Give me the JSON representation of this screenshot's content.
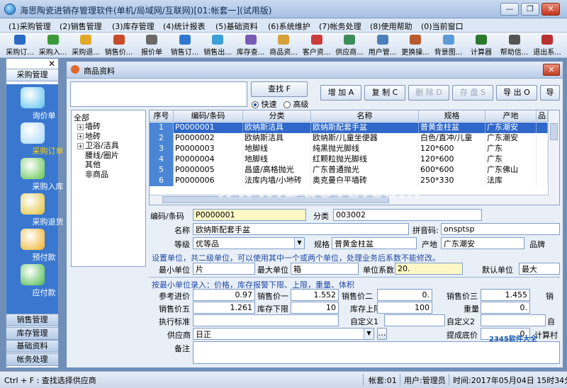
{
  "window": {
    "title": "海思陶瓷进销存管理软件(单机/局域网/互联网)[01:帐套一](试用版)",
    "buttons": [
      "—",
      "❐",
      "✕"
    ]
  },
  "menu": [
    "(1)采购管理",
    "(2)销售管理",
    "(3)库存管理",
    "(4)统计报表",
    "(5)基础资料",
    "(6)系统维护",
    "(7)帐务处理",
    "(8)使用帮助",
    "(0)当前窗口"
  ],
  "toolbar": [
    {
      "label": "采购订...",
      "color": "#2a6bc4"
    },
    {
      "label": "采购入...",
      "color": "#3a9a3a"
    },
    {
      "label": "采购退...",
      "color": "#e1a92a"
    },
    {
      "label": "销售价...",
      "color": "#c84b2a"
    },
    {
      "label": "报价单",
      "color": "#6b6b6b"
    },
    {
      "label": "销售订...",
      "color": "#2f78cf"
    },
    {
      "label": "销售出...",
      "color": "#3aa0d8"
    },
    {
      "label": "库存查...",
      "color": "#7a5bb8"
    },
    {
      "label": "商品资...",
      "color": "#d6a13a"
    },
    {
      "label": "客户资...",
      "color": "#cc3b3b"
    },
    {
      "label": "供应商...",
      "color": "#3c8d5b"
    },
    {
      "label": "用户管...",
      "color": "#4d7fb8"
    },
    {
      "label": "更换操...",
      "color": "#b85a2e"
    },
    {
      "label": "背景图...",
      "color": "#5b9bd8"
    },
    {
      "label": "计算器",
      "color": "#2b7a2b"
    },
    {
      "label": "帮助信...",
      "color": "#555"
    },
    {
      "label": "退出系...",
      "color": "#bb3030"
    }
  ],
  "sidebar": {
    "close": "✕",
    "top_group": "采购管理",
    "items": [
      {
        "label": "询价单",
        "color": "#58c0f0",
        "selected": false
      },
      {
        "label": "采购订单",
        "color": "#a8d8ff",
        "selected": true
      },
      {
        "label": "采购入库",
        "color": "#5ec44a",
        "selected": false
      },
      {
        "label": "采购退货",
        "color": "#e0c030",
        "selected": false
      },
      {
        "label": "预付款",
        "color": "#f0b020",
        "selected": false
      },
      {
        "label": "应付款",
        "color": "#4ab84a",
        "selected": false
      }
    ],
    "groups": [
      "销售管理",
      "库存管理",
      "基础资料",
      "帐务处理"
    ]
  },
  "child": {
    "title": "商品资料",
    "close": "✕",
    "search_btn": "查找 F",
    "radio_fast": "快速",
    "radio_adv": "高级",
    "actions": [
      {
        "label": "增 加 A",
        "disabled": false
      },
      {
        "label": "复 制 C",
        "disabled": false
      },
      {
        "label": "删 除 D",
        "disabled": true
      },
      {
        "label": "存 盘 S",
        "disabled": true
      },
      {
        "label": "导 出 O",
        "disabled": false
      },
      {
        "label": "导",
        "disabled": false
      }
    ],
    "tree": {
      "root": "全部",
      "nodes": [
        {
          "label": "墙砖",
          "expand": "+"
        },
        {
          "label": "地砖",
          "expand": "+"
        },
        {
          "label": "卫浴/洁具",
          "expand": "+"
        },
        {
          "label": "腰线/圈片",
          "expand": ""
        },
        {
          "label": "其他",
          "expand": ""
        },
        {
          "label": "非商品",
          "expand": ""
        }
      ]
    },
    "grid": {
      "columns": [
        "序号",
        "编码/条码",
        "分类",
        "名称",
        "规格",
        "产地",
        "品"
      ],
      "rows": [
        [
          "1",
          "P0000001",
          "欧纳斯洁具",
          "欧纳斯配套手盆",
          "普黄金柱盆",
          "广东潮安",
          ""
        ],
        [
          "2",
          "P0000002",
          "欧纳斯洁具",
          "欧纳斯/儿童坐便器",
          "白色/直冲/儿童",
          "广东潮安",
          ""
        ],
        [
          "3",
          "P0000003",
          "地脚线",
          "纯黑抛光脚线",
          "120*600",
          "广东",
          ""
        ],
        [
          "4",
          "P0000004",
          "地脚线",
          "红颗粒抛光脚线",
          "120*600",
          "广东",
          ""
        ],
        [
          "5",
          "P0000005",
          "昌盛/高格抛光",
          "广东普通抛光",
          "600*600",
          "广东佛山",
          ""
        ],
        [
          "6",
          "P0000006",
          "法库内墙/小地砖",
          "奥克曼白平墙砖",
          "250*330",
          "法库",
          ""
        ]
      ]
    },
    "form": {
      "code_label": "编码/条码",
      "code": "P0000001",
      "cat_label": "分类",
      "cat": "003002",
      "name_label": "名称",
      "name": "欧纳斯配套手盆",
      "pinyin_label": "拼音码:",
      "pinyin": "onsptsp",
      "grade_label": "等级",
      "grade": "优等品",
      "spec_label": "规格",
      "spec": "普黄金柱盆",
      "origin_label": "产地",
      "origin": "广东潮安",
      "brand_label": "品牌",
      "unit_hint": "设置单位，共二级单位，可以使用其中一个或两个单位，处理业务后系数不能修改。",
      "min_unit_label": "最小单位",
      "min_unit": "片",
      "max_unit_label": "最大单位",
      "max_unit": "箱",
      "factor_label": "单位系数",
      "factor": "20.",
      "default_unit_label": "默认单位",
      "default_unit": "最大",
      "price_hint": "按最小单位录入：价格，库存报警下限、上限，重量、体积",
      "ref_price_label": "参考进价",
      "ref_price": "0.97",
      "sp1_label": "销售价一",
      "sp1": "1.552",
      "sp2_label": "销售价二",
      "sp2": "0.",
      "sp3_label": "销售价三",
      "sp3": "1.455",
      "sp4_label": "销",
      "sp5_label": "销售价五",
      "sp5": "1.261",
      "stock_low_label": "库存下限",
      "stock_low": "10",
      "stock_high_label": "库存上限",
      "stock_high": "100",
      "weight_label": "重量",
      "weight": "0.",
      "std_label": "执行标准",
      "c1_label": "自定义1",
      "c2_label": "自定义2",
      "c3_label": "自",
      "supplier_label": "供应商",
      "supplier": "日正",
      "min_price_label": "提成底价",
      "min_price": "0.",
      "calc_label": "计算村",
      "memo_label": "备注"
    }
  },
  "status": {
    "hint": "Ctrl + F : 查找选择供应商",
    "account": "帐套:01",
    "user": "用户:管理员",
    "time": "时间:2017年05月04日  15时34分"
  },
  "watermark": "www.DuoTe.com",
  "watermark2": "2345软件大全"
}
